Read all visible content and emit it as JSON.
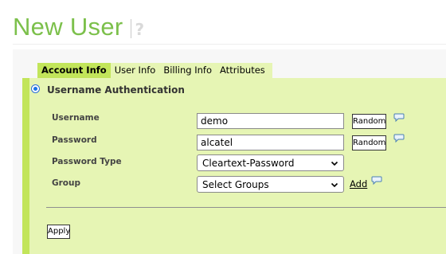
{
  "page": {
    "title": "New User",
    "help_glyph": "?"
  },
  "tabs": [
    {
      "label": "Account Info",
      "active": true
    },
    {
      "label": "User Info",
      "active": false
    },
    {
      "label": "Billing Info",
      "active": false
    },
    {
      "label": "Attributes",
      "active": false
    }
  ],
  "section": {
    "title": "Username Authentication",
    "selected": true
  },
  "form": {
    "username": {
      "label": "Username",
      "value": "demo",
      "random_label": "Random"
    },
    "password": {
      "label": "Password",
      "value": "alcatel",
      "random_label": "Random"
    },
    "password_type": {
      "label": "Password Type",
      "selected": "Cleartext-Password"
    },
    "group": {
      "label": "Group",
      "selected": "Select Groups",
      "add_label": "Add"
    }
  },
  "actions": {
    "apply_label": "Apply"
  },
  "colors": {
    "title_green": "#7cc04b",
    "panel_bg": "#e6f5b4",
    "tab_active": "#c2e55a"
  },
  "icons": {
    "help": "help-icon",
    "comment": "speech-bubble-icon",
    "dropdown": "chevron-down-icon"
  }
}
